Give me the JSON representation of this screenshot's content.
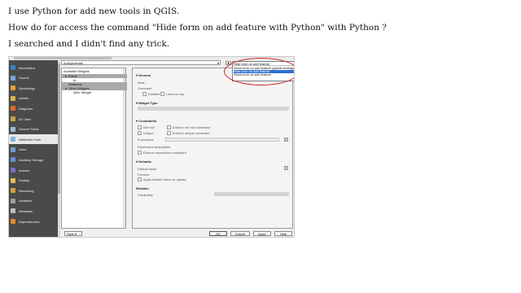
{
  "question": {
    "line1": "I use Python for add new tools in QGIS.",
    "line2": "How do for access the command \"Hide form on add feature with Python\" with Python ?",
    "line3": "I searched and I didn't find any trick."
  },
  "dialog": {
    "sidebar": {
      "items": [
        {
          "label": "Information",
          "icon": "info-icon",
          "color": "#3b82c4"
        },
        {
          "label": "Source",
          "icon": "source-icon",
          "color": "#7aa7d8"
        },
        {
          "label": "Symbology",
          "icon": "symbology-icon",
          "color": "#e0a030"
        },
        {
          "label": "Labels",
          "icon": "labels-icon",
          "color": "#d9b44a"
        },
        {
          "label": "Diagrams",
          "icon": "diagrams-icon",
          "color": "#e06a2b"
        },
        {
          "label": "3D View",
          "icon": "3d-view-icon",
          "color": "#c8a04a"
        },
        {
          "label": "Source Fields",
          "icon": "source-fields-icon",
          "color": "#9fb7d6"
        },
        {
          "label": "Attributes Form",
          "icon": "attributes-form-icon",
          "color": "#8ab0d8"
        },
        {
          "label": "Joins",
          "icon": "joins-icon",
          "color": "#6ea0d0"
        },
        {
          "label": "Auxiliary Storage",
          "icon": "auxiliary-storage-icon",
          "color": "#5f8fc4"
        },
        {
          "label": "Actions",
          "icon": "actions-icon",
          "color": "#7b6ad0"
        },
        {
          "label": "Display",
          "icon": "display-icon",
          "color": "#e0c050"
        },
        {
          "label": "Rendering",
          "icon": "rendering-icon",
          "color": "#d0a040"
        },
        {
          "label": "Variables",
          "icon": "variables-icon",
          "color": "#a0a0a0"
        },
        {
          "label": "Metadata",
          "icon": "metadata-icon",
          "color": "#c0c0c0"
        },
        {
          "label": "Dependencies",
          "icon": "dependencies-icon",
          "color": "#e08a30"
        }
      ],
      "active_index": 7
    },
    "layout_combo": "Autogenerate",
    "tree": {
      "header": "Available Widgets",
      "rows": [
        {
          "label": "Fields",
          "depth": 1,
          "expander": "▾",
          "selected": true
        },
        {
          "label": "id",
          "depth": 2,
          "expander": "",
          "selected": false
        },
        {
          "label": "Relations",
          "depth": 1,
          "expander": "",
          "selected": true
        },
        {
          "label": "Other Widgets",
          "depth": 1,
          "expander": "▾",
          "selected": true
        },
        {
          "label": "QML Widget",
          "depth": 2,
          "expander": "",
          "selected": false
        }
      ]
    },
    "panel": {
      "general": "General",
      "alias": "Alias",
      "comment": "Comment",
      "editable": "Editable",
      "label_on_top": "Label on top",
      "widget_type": "Widget Type",
      "constraints": "Constraints",
      "not_null": "Not null",
      "enforce_not_null": "Enforce not null constraint",
      "unique": "Unique",
      "enforce_unique": "Enforce unique constraint",
      "expression": "Expression",
      "expression_description": "Expression description",
      "enforce_expression": "Enforce expression constraint",
      "defaults": "Defaults",
      "default_value": "Default value",
      "preview": "Preview",
      "apply_on_update": "Apply default value on update",
      "relation": "Relation",
      "cardinality": "Cardinality"
    },
    "dropdown": {
      "current": "Hide form on add feature",
      "options": [
        {
          "label": "Show form on add feature (global settings)",
          "selected": false
        },
        {
          "label": "Hide form on add feature",
          "selected": true
        },
        {
          "label": "Show form on add feature",
          "selected": false
        }
      ]
    },
    "buttons": {
      "style": "Style",
      "ok": "OK",
      "cancel": "Cancel",
      "apply": "Apply",
      "help": "Help"
    },
    "accent_color": "#2f6fd6",
    "highlight_color": "#d11e1e"
  }
}
